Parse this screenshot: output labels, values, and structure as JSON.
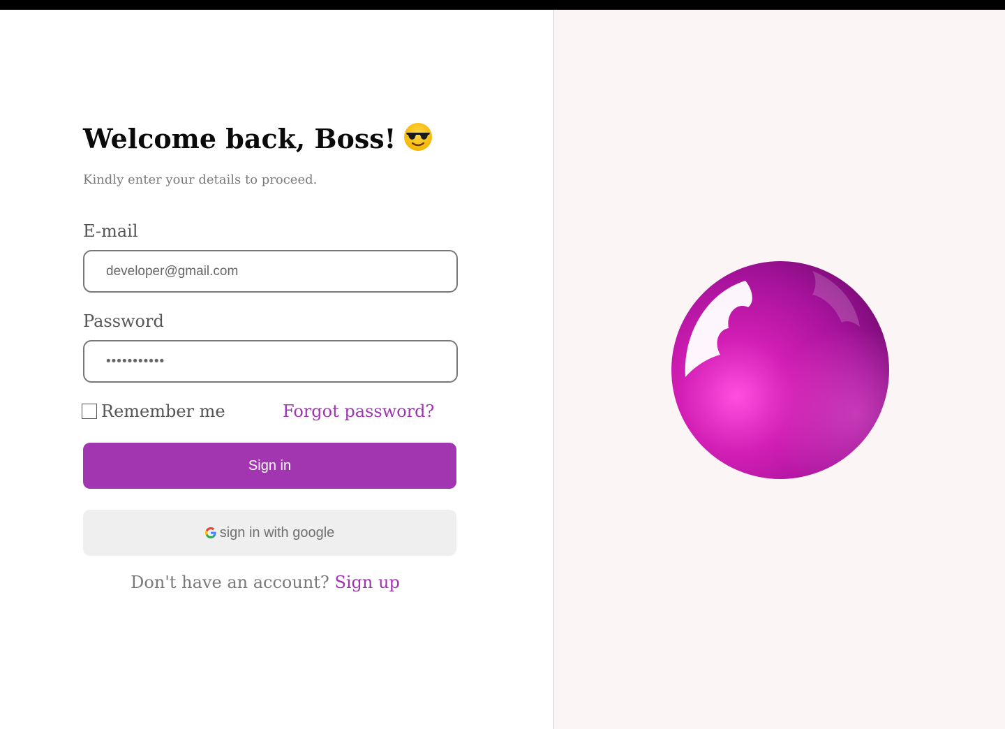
{
  "header": {
    "title": "Welcome back, Boss!",
    "subtitle": "Kindly enter your details to proceed."
  },
  "form": {
    "email_label": "E-mail",
    "email_placeholder": "developer@gmail.com",
    "password_label": "Password",
    "password_value": "•••••••••••",
    "remember_label": "Remember me",
    "remember_checked": false,
    "forgot_label": "Forgot password?",
    "signin_label": "Sign in",
    "google_label": "sign in with google",
    "no_account_text": "Don't have an account?",
    "signup_label": "Sign up"
  },
  "icons": {
    "title_emoji": "smiling-face-with-sunglasses-icon",
    "google": "google-g-icon",
    "illustration": "magenta-sphere"
  },
  "colors": {
    "accent": "#a136b0",
    "link": "#a035b1",
    "right_panel_bg": "#fbf5f5",
    "google_button_bg": "#efefef"
  }
}
